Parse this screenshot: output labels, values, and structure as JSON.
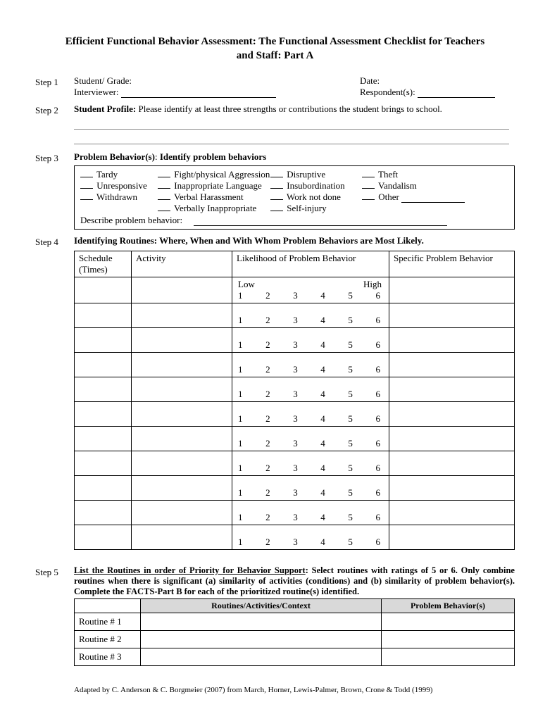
{
  "title": "Efficient Functional Behavior Assessment: The Functional Assessment Checklist for Teachers and Staff: Part A",
  "steps": {
    "s1": "Step 1",
    "s2": "Step 2",
    "s3": "Step 3",
    "s4": "Step 4",
    "s5": "Step 5"
  },
  "step1": {
    "studentGrade": "Student/ Grade:",
    "date": "Date:",
    "interviewer": "Interviewer:",
    "respondents": "Respondent(s):"
  },
  "step2": {
    "profileLabel": "Student Profile:",
    "profileText": " Please identify at least three strengths or contributions the student brings to school."
  },
  "step3": {
    "label": "Problem Behavior(s)",
    "instruction": "Identify problem behaviors",
    "col1": {
      "a": "Tardy",
      "b": "Unresponsive",
      "c": "Withdrawn"
    },
    "col2": {
      "a": "Fight/physical Aggression",
      "b": "Inappropriate Language",
      "c": "Verbal Harassment",
      "d": "Verbally Inappropriate"
    },
    "col3": {
      "a": "Disruptive",
      "b": "Insubordination",
      "c": "Work not done",
      "d": "Self-injury"
    },
    "col4": {
      "a": "Theft",
      "b": "Vandalism",
      "c": "Other"
    },
    "describe": "Describe problem behavior:"
  },
  "step4": {
    "heading": "Identifying Routines: Where, When and With Whom Problem Behaviors are Most Likely.",
    "colSched": "Schedule (Times)",
    "colAct": "Activity",
    "colLike": "Likelihood of Problem Behavior",
    "colSpec": "Specific Problem Behavior",
    "low": "Low",
    "high": "High",
    "nums": {
      "n1": "1",
      "n2": "2",
      "n3": "3",
      "n4": "4",
      "n5": "5",
      "n6": "6"
    }
  },
  "step5": {
    "lead": "List the Routines in order of Priority for Behavior Support",
    "rest": ": Select routines with ratings of 5 or 6.  Only combine routines when there is significant (a) similarity of activities (conditions) and (b) similarity of problem behavior(s).  Complete the FACTS-Part B for each of the prioritized routine(s) identified.",
    "hdr1": "Routines/Activities/Context",
    "hdr2": "Problem Behavior(s)",
    "r1": "Routine # 1",
    "r2": "Routine # 2",
    "r3": "Routine # 3"
  },
  "footer": "Adapted by C. Anderson & C. Borgmeier (2007) from March, Horner, Lewis-Palmer, Brown, Crone & Todd (1999)"
}
